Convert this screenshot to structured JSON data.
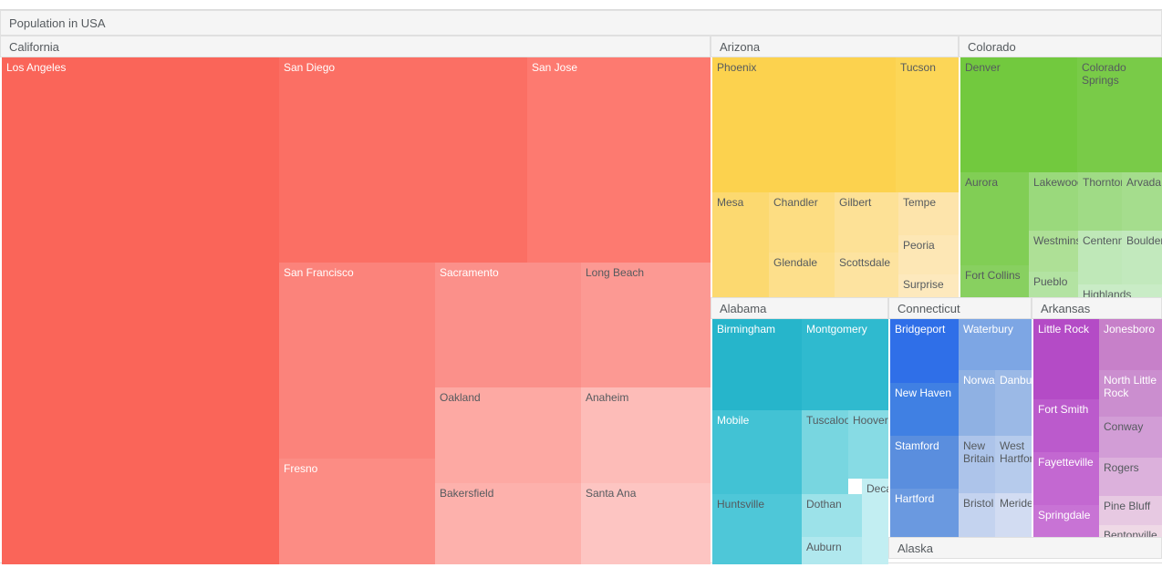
{
  "chart_data": {
    "type": "treemap",
    "title": "Population in USA",
    "grid": false,
    "legend": "none",
    "groups": [
      {
        "name": "California",
        "accent": "#fa6a5e",
        "leaves": [
          {
            "label": "Los Angeles",
            "color": "#fa6559",
            "text": "light"
          },
          {
            "label": "San Diego",
            "color": "#fb6f64",
            "text": "light"
          },
          {
            "label": "San Jose",
            "color": "#fd7a70",
            "text": "light"
          },
          {
            "label": "San Francisco",
            "color": "#fb837b",
            "text": "light"
          },
          {
            "label": "Fresno",
            "color": "#fc8c84",
            "text": "light"
          },
          {
            "label": "Sacramento",
            "color": "#fb908a",
            "text": "light"
          },
          {
            "label": "Long Beach",
            "color": "#fc9993",
            "text": "dark"
          },
          {
            "label": "Oakland",
            "color": "#fda9a3",
            "text": "dark"
          },
          {
            "label": "Bakersfield",
            "color": "#fdb1ac",
            "text": "dark"
          },
          {
            "label": "Anaheim",
            "color": "#fdbcb8",
            "text": "dark"
          },
          {
            "label": "Santa Ana",
            "color": "#fdc5c2",
            "text": "dark"
          }
        ]
      },
      {
        "name": "Arizona",
        "accent": "#fcd34f",
        "leaves": [
          {
            "label": "Phoenix",
            "color": "#fcd24e",
            "text": "dark"
          },
          {
            "label": "Tucson",
            "color": "#fcd657",
            "text": "dark"
          },
          {
            "label": "Mesa",
            "color": "#fcd970",
            "text": "dark"
          },
          {
            "label": "Chandler",
            "color": "#fddd82",
            "text": "dark"
          },
          {
            "label": "Glendale",
            "color": "#fddf8b",
            "text": "dark"
          },
          {
            "label": "Gilbert",
            "color": "#fde196",
            "text": "dark"
          },
          {
            "label": "Scottsdale",
            "color": "#fde3a0",
            "text": "dark"
          },
          {
            "label": "Tempe",
            "color": "#fde4ab",
            "text": "dark"
          },
          {
            "label": "Peoria",
            "color": "#fde7b5",
            "text": "dark"
          },
          {
            "label": "Surprise",
            "color": "#fde9bd",
            "text": "dark"
          }
        ]
      },
      {
        "name": "Colorado",
        "accent": "#73c93f",
        "leaves": [
          {
            "label": "Denver",
            "color": "#72c93e",
            "text": "dark"
          },
          {
            "label": "Colorado Springs",
            "color": "#79cb48",
            "text": "dark"
          },
          {
            "label": "Aurora",
            "color": "#81ce55",
            "text": "dark"
          },
          {
            "label": "Fort Collins",
            "color": "#88d060",
            "text": "dark"
          },
          {
            "label": "Lakewood",
            "color": "#9ad97c",
            "text": "dark"
          },
          {
            "label": "Thornton",
            "color": "#a0db86",
            "text": "dark"
          },
          {
            "label": "Arvada",
            "color": "#a5dd8d",
            "text": "dark"
          },
          {
            "label": "Westminster",
            "color": "#aee096",
            "text": "dark"
          },
          {
            "label": "Pueblo",
            "color": "#b3e3a2",
            "text": "dark"
          },
          {
            "label": "Centennial",
            "color": "#bfe8b8",
            "text": "dark"
          },
          {
            "label": "Boulder",
            "color": "#c2e9bd",
            "text": "dark"
          },
          {
            "label": "Highlands",
            "color": "#c9ecc6",
            "text": "dark"
          }
        ]
      },
      {
        "name": "Alabama",
        "accent": "#26b6cc",
        "leaves": [
          {
            "label": "Birmingham",
            "color": "#26b5cb",
            "text": "light"
          },
          {
            "label": "Montgomery",
            "color": "#2fbacf",
            "text": "light"
          },
          {
            "label": "Mobile",
            "color": "#42c2d4",
            "text": "light"
          },
          {
            "label": "Huntsville",
            "color": "#4ec7d8",
            "text": "dark"
          },
          {
            "label": "Tuscaloosa",
            "color": "#78d6e0",
            "text": "dark"
          },
          {
            "label": "Hoover",
            "color": "#87dbe4",
            "text": "dark"
          },
          {
            "label": "Dothan",
            "color": "#9ce2e9",
            "text": "dark"
          },
          {
            "label": "Auburn",
            "color": "#b0e8ee",
            "text": "dark"
          },
          {
            "label": "Decatur",
            "color": "#c2eef2",
            "text": "dark"
          }
        ]
      },
      {
        "name": "Connecticut",
        "accent": "#2f6fe8",
        "leaves": [
          {
            "label": "Bridgeport",
            "color": "#2f6fe8",
            "text": "light"
          },
          {
            "label": "New Haven",
            "color": "#4080e3",
            "text": "light"
          },
          {
            "label": "Stamford",
            "color": "#5a8ede",
            "text": "light"
          },
          {
            "label": "Hartford",
            "color": "#6a99e0",
            "text": "light"
          },
          {
            "label": "Waterbury",
            "color": "#7da6e4",
            "text": "light"
          },
          {
            "label": "Norwalk",
            "color": "#8fb1e3",
            "text": "light"
          },
          {
            "label": "Danbury",
            "color": "#9bb9e6",
            "text": "light"
          },
          {
            "label": "New Britain",
            "color": "#adc4ea",
            "text": "dark"
          },
          {
            "label": "West Hartford",
            "color": "#b6cbec",
            "text": "dark"
          },
          {
            "label": "Bristol",
            "color": "#c4d3ef",
            "text": "dark"
          },
          {
            "label": "Meriden",
            "color": "#d2dcf2",
            "text": "dark"
          }
        ]
      },
      {
        "name": "Arkansas",
        "accent": "#b44bc6",
        "leaves": [
          {
            "label": "Little Rock",
            "color": "#b44bc6",
            "text": "light"
          },
          {
            "label": "Fort Smith",
            "color": "#bb5acc",
            "text": "light"
          },
          {
            "label": "Fayetteville",
            "color": "#c368d1",
            "text": "light"
          },
          {
            "label": "Springdale",
            "color": "#c873d5",
            "text": "light"
          },
          {
            "label": "Jonesboro",
            "color": "#c780c9",
            "text": "light"
          },
          {
            "label": "North Little Rock",
            "color": "#cb8ecf",
            "text": "light"
          },
          {
            "label": "Conway",
            "color": "#d29dd6",
            "text": "dark"
          },
          {
            "label": "Rogers",
            "color": "#dcb1dc",
            "text": "dark"
          },
          {
            "label": "Pine Bluff",
            "color": "#e7c9e2",
            "text": "dark"
          },
          {
            "label": "Bentonville",
            "color": "#efd9e6",
            "text": "dark"
          }
        ]
      },
      {
        "name": "Alaska",
        "accent": "#f5f5f5",
        "leaves": []
      }
    ]
  },
  "headers": {
    "root": "Population in USA",
    "california": "California",
    "arizona": "Arizona",
    "colorado": "Colorado",
    "alabama": "Alabama",
    "connecticut": "Connecticut",
    "arkansas": "Arkansas",
    "alaska": "Alaska"
  },
  "labels": {
    "ca": {
      "los_angeles": "Los Angeles",
      "san_diego": "San Diego",
      "san_jose": "San Jose",
      "san_francisco": "San Francisco",
      "fresno": "Fresno",
      "sacramento": "Sacramento",
      "long_beach": "Long Beach",
      "oakland": "Oakland",
      "bakersfield": "Bakersfield",
      "anaheim": "Anaheim",
      "santa_ana": "Santa Ana"
    },
    "az": {
      "phoenix": "Phoenix",
      "tucson": "Tucson",
      "mesa": "Mesa",
      "chandler": "Chandler",
      "glendale": "Glendale",
      "gilbert": "Gilbert",
      "scottsdale": "Scottsdale",
      "tempe": "Tempe",
      "peoria": "Peoria",
      "surprise": "Surprise"
    },
    "co": {
      "denver": "Denver",
      "colorado_springs": "Colorado Springs",
      "aurora": "Aurora",
      "fort_collins": "Fort Collins",
      "lakewood": "Lakewood",
      "thornton": "Thornton",
      "arvada": "Arvada",
      "westminster": "Westminster",
      "pueblo": "Pueblo",
      "centennial": "Centennial",
      "boulder": "Boulder",
      "highlands": "Highlands"
    },
    "al": {
      "birmingham": "Birmingham",
      "montgomery": "Montgomery",
      "mobile": "Mobile",
      "huntsville": "Huntsville",
      "tuscaloosa": "Tuscaloosa",
      "hoover": "Hoover",
      "dothan": "Dothan",
      "auburn": "Auburn",
      "decatur": "Decatur"
    },
    "ct": {
      "bridgeport": "Bridgeport",
      "new_haven": "New Haven",
      "stamford": "Stamford",
      "hartford": "Hartford",
      "waterbury": "Waterbury",
      "norwalk": "Norwalk",
      "danbury": "Danbury",
      "new_britain": "New Britain",
      "west_hartford": "West Hartford",
      "bristol": "Bristol",
      "meriden": "Meriden"
    },
    "ar": {
      "little_rock": "Little Rock",
      "fort_smith": "Fort Smith",
      "fayetteville": "Fayetteville",
      "springdale": "Springdale",
      "jonesboro": "Jonesboro",
      "north_little_rock": "North Little Rock",
      "conway": "Conway",
      "rogers": "Rogers",
      "pine_bluff": "Pine Bluff",
      "bentonville": "Bentonville"
    }
  }
}
